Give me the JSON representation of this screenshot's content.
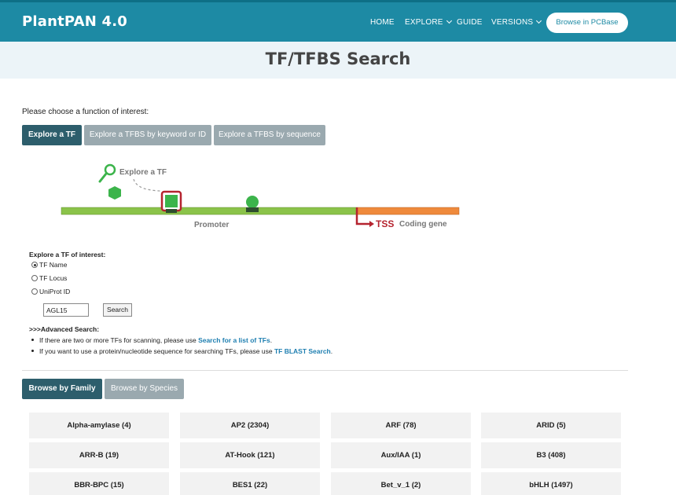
{
  "brand": "PlantPAN 4.0",
  "nav": {
    "home": "HOME",
    "explore": "EXPLORE",
    "guide": "GUIDE",
    "versions": "VERSIONS",
    "pcbase": "Browse in PCBase"
  },
  "page_title": "TF/TFBS Search",
  "intro": "Please choose a function of interest:",
  "tabs": {
    "explore_tf": "Explore a TF",
    "explore_keyword": "Explore a TFBS by keyword or ID",
    "explore_sequence": "Explore a TFBS by sequence"
  },
  "diagram": {
    "explore_label": "Explore a TF",
    "promoter": "Promoter",
    "tss": "TSS",
    "coding": "Coding gene",
    "colors": {
      "green": "#8bc34a",
      "orange": "#ef8a3c",
      "red": "#b5242f",
      "tf_green": "#3cb44b",
      "dark": "#2e4d2e"
    }
  },
  "form": {
    "title": "Explore a TF of interest:",
    "options": [
      "TF Name",
      "TF Locus",
      "UniProt ID"
    ],
    "selected": "TF Name",
    "input_value": "AGL15",
    "search_label": "Search"
  },
  "advanced": {
    "title": ">>>Advanced Search:",
    "line1_text": "If there are two or more TFs for scanning, please use ",
    "line1_link": "Search for a list of TFs",
    "line1_end": ".",
    "line2_text": "If you want to use a protein/nucleotide sequence for searching TFs, please use ",
    "line2_link": "TF BLAST Search",
    "line2_end": "."
  },
  "browse": {
    "family": "Browse by Family",
    "species": "Browse by Species"
  },
  "families": [
    "Alpha-amylase (4)",
    "AP2 (2304)",
    "ARF (78)",
    "ARID (5)",
    "ARR-B (19)",
    "AT-Hook (121)",
    "Aux/IAA (1)",
    "B3 (408)",
    "BBR-BPC (15)",
    "BES1 (22)",
    "Bet_v_1 (2)",
    "bHLH (1497)"
  ],
  "colors": {
    "nav": "#1d8aa4",
    "active_tab": "#2d5e6c",
    "inactive_tab": "#9aa9af",
    "link": "#1d7eb0"
  }
}
